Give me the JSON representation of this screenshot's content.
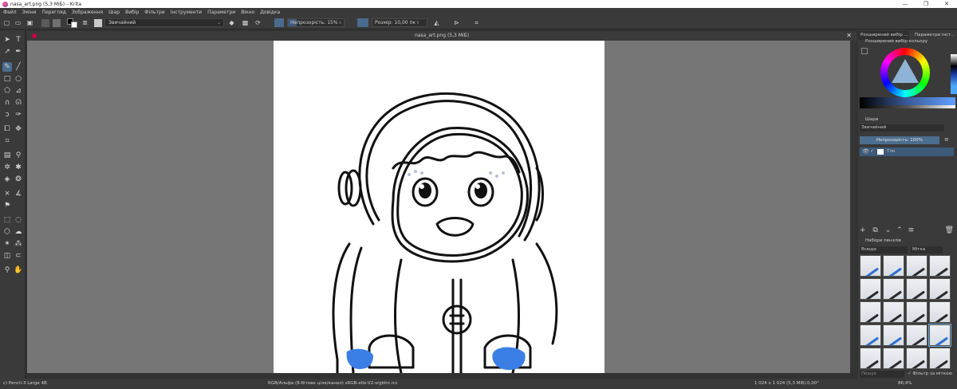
{
  "window": {
    "title": "nasa_art.png (5,3 МіБ) – Krita",
    "controls": [
      "—",
      "❐",
      "✕"
    ]
  },
  "menu": [
    "Файл",
    "Зміни",
    "Перегляд",
    "Зображення",
    "Шар",
    "Вибір",
    "Фільтри",
    "Інструменти",
    "Параметри",
    "Вікно",
    "Довідка"
  ],
  "toolbar": {
    "blend_mode": "Звичайний",
    "opacity_label": "Непрозорість: 15%",
    "opacity_value": 15,
    "size_label": "Розмір: 10,00 пк",
    "colors": {
      "foreground": "#000000",
      "background": "#ffffff",
      "accent": "#4b6d8e"
    }
  },
  "document": {
    "tab_title": "nasa_art.png (5,3 МіБ)",
    "close": "✕"
  },
  "dock": {
    "tabs": [
      "Розширений вибір ...",
      "Параметри інст..."
    ],
    "color_selector_title": "Розширений вибір кольору",
    "layers_title": "Шари",
    "layers_blend": "Звичайний",
    "layers_opacity": "Непрозорість: 100%",
    "layer_name": "Тло",
    "brush_presets_title": "Набори пензлів",
    "brush_filter": "Всюди",
    "brush_tag": "Мітка",
    "search_placeholder": "Пошук",
    "filter_by_tag": "Фільтр за міткою"
  },
  "status": {
    "brush": "c) Pencil-3 Large 4B",
    "color_info": "RGB/Альфа (8-бітове ціле/канал)  sRGB-elle-V2-srgbtrc.icc",
    "dimensions": "1 024 x 1 024 (5,3 МіБ)",
    "rotation": "0,00°",
    "zoom": "86,4%"
  }
}
